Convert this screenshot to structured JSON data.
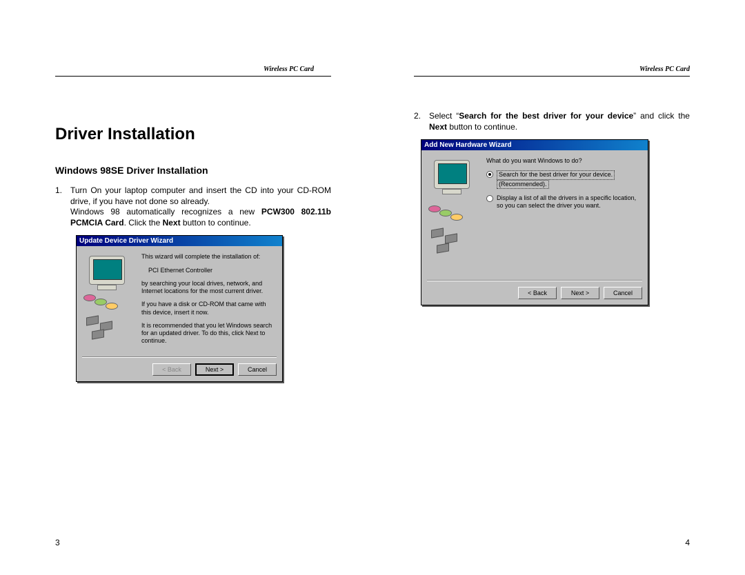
{
  "header_label": "Wireless PC Card",
  "left": {
    "h1": "Driver Installation",
    "h2": "Windows 98SE Driver Installation",
    "step1_num": "1.",
    "step1_line1": "Turn On your laptop computer and insert the CD into your CD-ROM drive, if you have not done so already.",
    "step1_line2a": "Windows 98 automatically recognizes a new ",
    "step1_bold": "PCW300 802.11b PCMCIA Card",
    "step1_line2b": ".  Click the ",
    "step1_bold2": "Next",
    "step1_line2c": " button to continue.",
    "dialog": {
      "title": "Update Device Driver Wizard",
      "p1": "This wizard will complete the installation of:",
      "p2": "PCI Ethernet Controller",
      "p3": "by searching your local drives, network, and Internet locations for the most current driver.",
      "p4": "If you have a disk or CD-ROM that came with this device, insert it now.",
      "p5": "It is recommended that you let Windows search for an updated driver. To do this, click Next to continue.",
      "back": "< Back",
      "next": "Next >",
      "cancel": "Cancel"
    },
    "page_num": "3"
  },
  "right": {
    "step2_num": "2.",
    "step2_a": "Select “",
    "step2_bold1": "Search for the best driver for your device",
    "step2_b": "” and click the ",
    "step2_bold2": "Next",
    "step2_c": " button to continue.",
    "dialog": {
      "title": "Add New Hardware Wizard",
      "prompt": "What do you want Windows to do?",
      "opt1a": "Search for the best driver for your device.",
      "opt1b": "(Recommended).",
      "opt2": "Display a list of all the drivers in a specific location, so you can select the driver you want.",
      "back": "< Back",
      "next": "Next >",
      "cancel": "Cancel"
    },
    "page_num": "4"
  }
}
